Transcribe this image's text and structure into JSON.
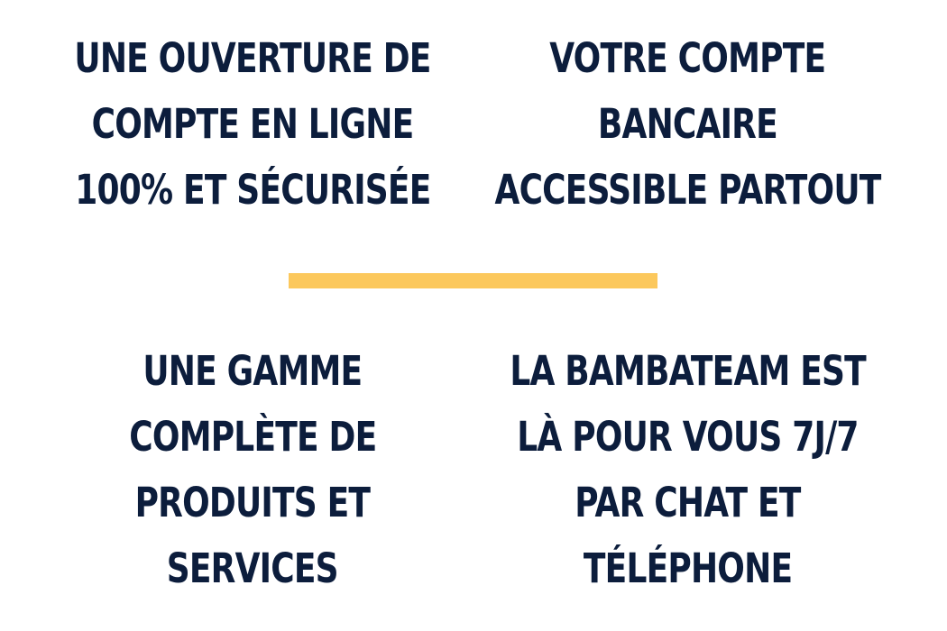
{
  "colors": {
    "text": "#0c1d3c",
    "accent": "#fcc85c",
    "background": "#ffffff"
  },
  "features": [
    {
      "lines": [
        "UNE OUVERTURE DE",
        "COMPTE EN LIGNE",
        "100% ET SÉCURISÉE"
      ]
    },
    {
      "lines": [
        "VOTRE COMPTE",
        "BANCAIRE",
        "ACCESSIBLE PARTOUT"
      ]
    },
    {
      "lines": [
        "UNE GAMME",
        "COMPLÈTE DE",
        "PRODUITS ET",
        "SERVICES"
      ]
    },
    {
      "lines": [
        "LA BAMBATEAM EST",
        "LÀ POUR VOUS 7J/7",
        "PAR CHAT ET",
        "TÉLÉPHONE"
      ]
    }
  ]
}
